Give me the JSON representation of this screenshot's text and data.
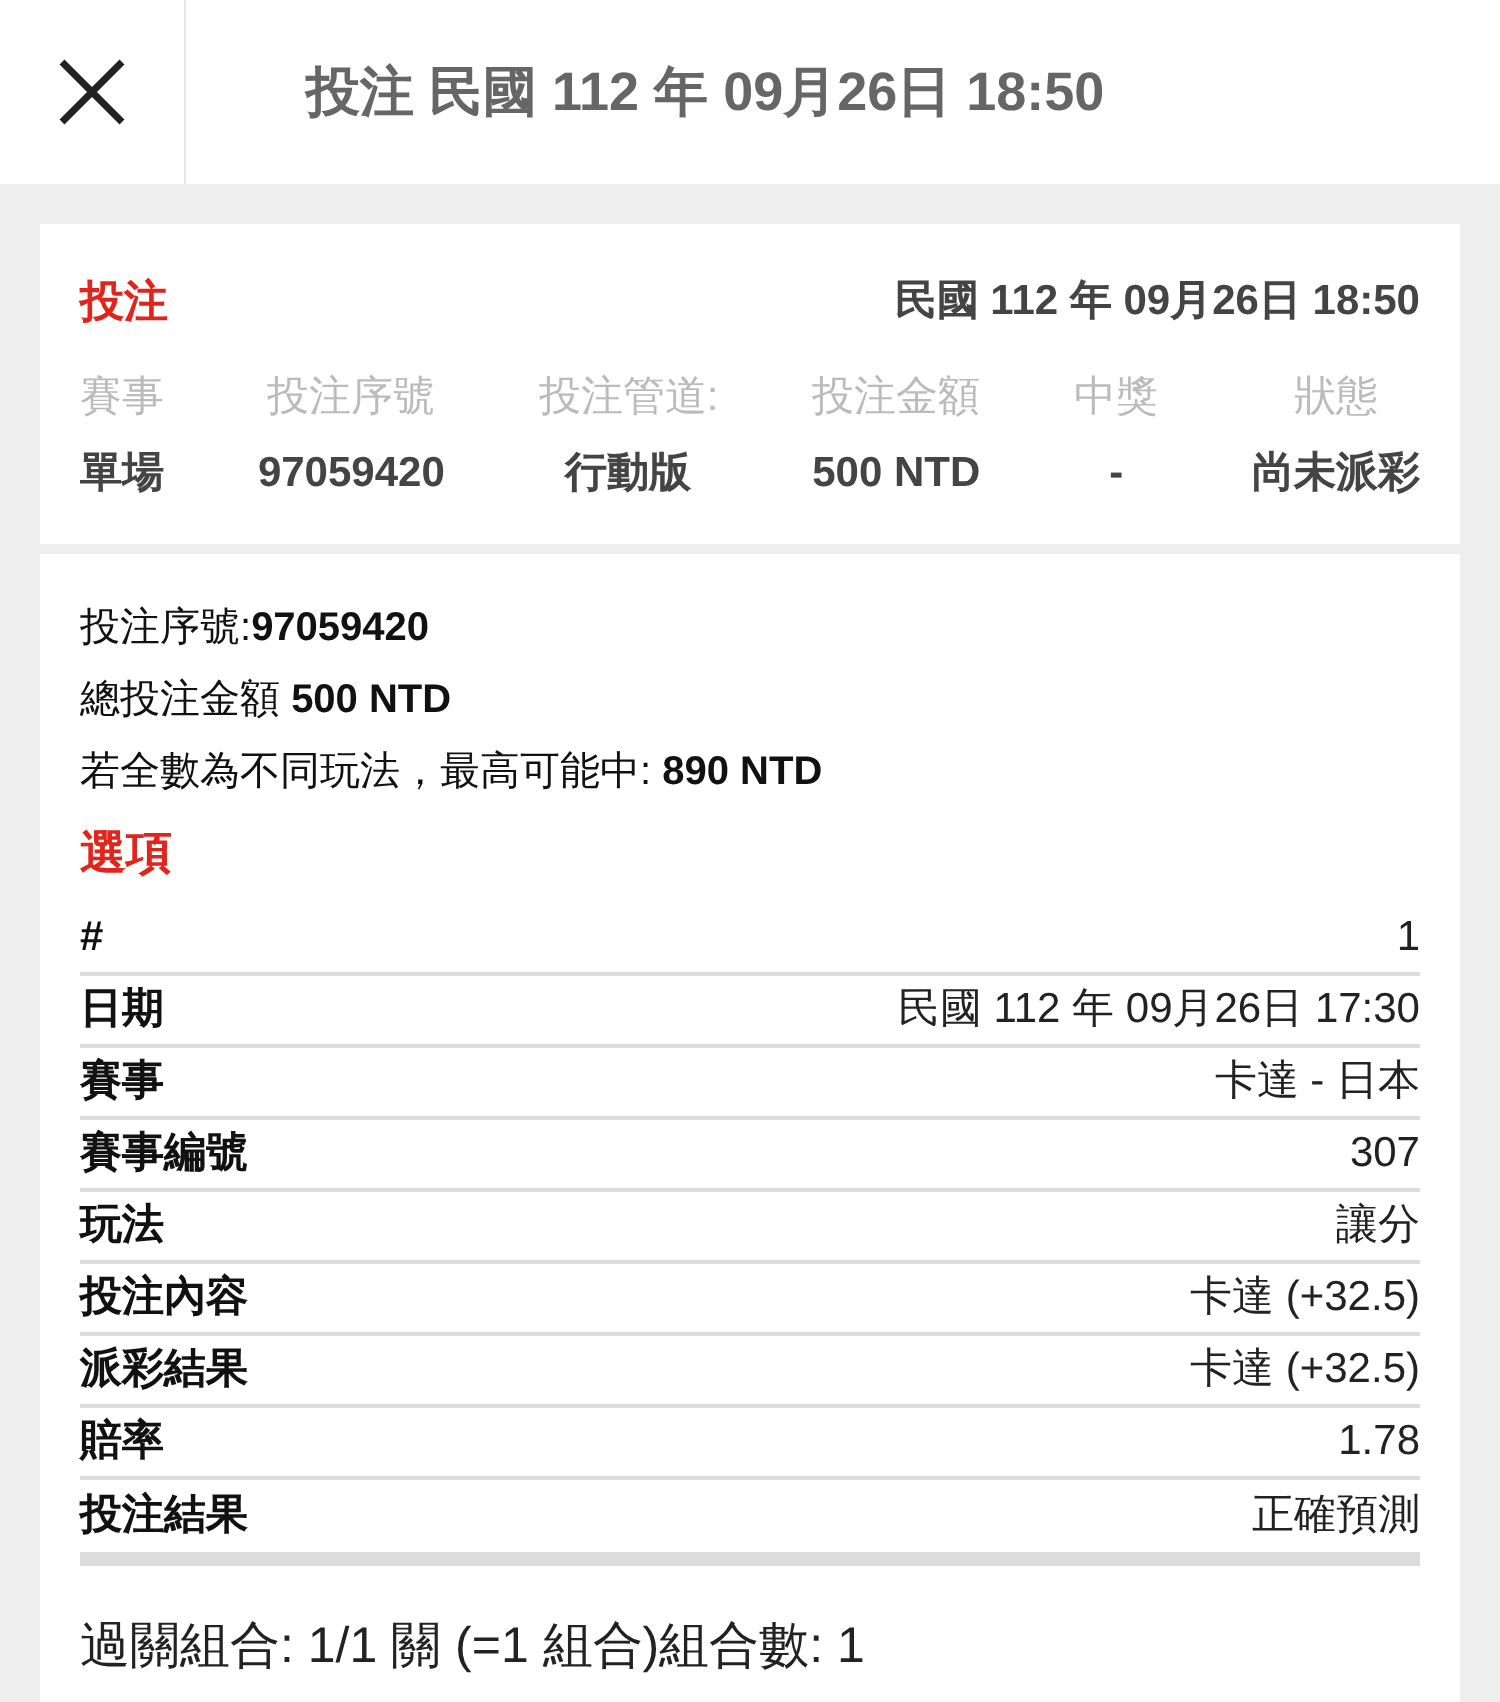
{
  "header": {
    "title": "投注 民國 112 年 09月26日 18:50"
  },
  "summary": {
    "label": "投注",
    "datetime": "民國 112 年 09月26日 18:50",
    "columns": [
      {
        "heading": "賽事",
        "value": "單場"
      },
      {
        "heading": "投注序號",
        "value": "97059420"
      },
      {
        "heading": "投注管道:",
        "value": "行動版"
      },
      {
        "heading": "投注金額",
        "value": "500 NTD"
      },
      {
        "heading": "中獎",
        "value": "-"
      },
      {
        "heading": "狀態",
        "value": "尚未派彩"
      }
    ]
  },
  "details": {
    "lines": [
      "投注序號:**97059420**",
      "總投注金額 **500 NTD**",
      "若全數為不同玩法，最高可能中: **890 NTD**"
    ],
    "section_title": "選項",
    "rows": [
      {
        "label": "#",
        "value": "1"
      },
      {
        "label": "日期",
        "value": "民國 112 年 09月26日 17:30"
      },
      {
        "label": "賽事",
        "value": "卡達 - 日本"
      },
      {
        "label": "賽事編號",
        "value": "307"
      },
      {
        "label": "玩法",
        "value": "讓分"
      },
      {
        "label": "投注內容",
        "value": "卡達 (+32.5)"
      },
      {
        "label": "派彩結果",
        "value": "卡達 (+32.5)"
      },
      {
        "label": "賠率",
        "value": "1.78"
      },
      {
        "label": "投注結果",
        "value": "正確預測"
      }
    ],
    "footer": "過關組合: 1/1 關 (=1 組合)組合數: 1"
  }
}
